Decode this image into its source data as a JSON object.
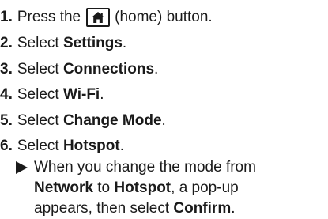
{
  "steps": [
    {
      "num": "1.",
      "pre": "Press the",
      "icon": "home-icon",
      "post": "(home) button."
    },
    {
      "num": "2.",
      "pre": "Select ",
      "bold": "Settings",
      "post": "."
    },
    {
      "num": "3.",
      "pre": "Select ",
      "bold": "Connections",
      "post": "."
    },
    {
      "num": "4.",
      "pre": "Select ",
      "bold": "Wi-Fi",
      "post": "."
    },
    {
      "num": "5.",
      "pre": "Select ",
      "bold": "Change Mode",
      "post": "."
    },
    {
      "num": "6.",
      "pre": "Select ",
      "bold": "Hotspot",
      "post": "."
    }
  ],
  "note": {
    "line1": "When you change the mode from",
    "line2_bold1": "Network",
    "line2_mid": " to ",
    "line2_bold2": "Hotspot",
    "line2_end": ", a pop-up",
    "line3_pre": "appears, then select ",
    "line3_bold": "Confirm",
    "line3_end": "."
  }
}
